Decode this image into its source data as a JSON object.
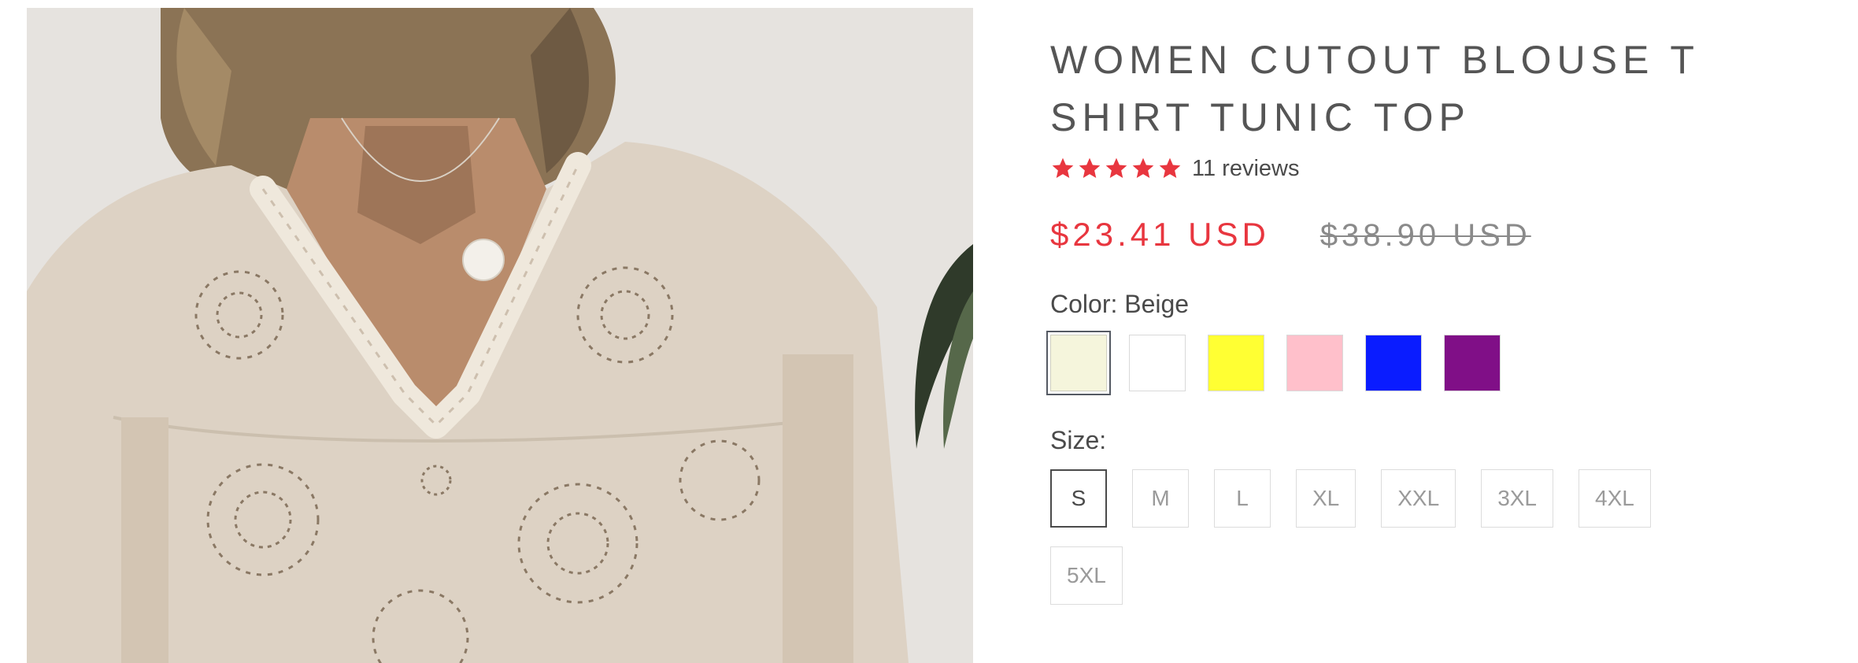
{
  "product": {
    "title": "WOMEN CUTOUT BLOUSE T SHIRT TUNIC TOP",
    "rating": 5,
    "reviews_text": "11 reviews",
    "price_sale": "$23.41 USD",
    "price_original": "$38.90 USD"
  },
  "colors": {
    "label": "Color: Beige",
    "options": [
      {
        "name": "Beige",
        "hex": "#f5f5dc",
        "selected": true
      },
      {
        "name": "White",
        "hex": "#ffffff",
        "selected": false
      },
      {
        "name": "Yellow",
        "hex": "#ffff33",
        "selected": false
      },
      {
        "name": "Pink",
        "hex": "#ffc0cb",
        "selected": false
      },
      {
        "name": "Blue",
        "hex": "#0a1cff",
        "selected": false
      },
      {
        "name": "Purple",
        "hex": "#800f87",
        "selected": false
      }
    ]
  },
  "sizes": {
    "label": "Size:",
    "options": [
      "S",
      "M",
      "L",
      "XL",
      "XXL",
      "3XL",
      "4XL",
      "5XL"
    ],
    "selected": "S"
  },
  "theme": {
    "star_color": "#e8363f",
    "sale_color": "#e8363f"
  },
  "icons": {
    "rating": "star-icon"
  }
}
